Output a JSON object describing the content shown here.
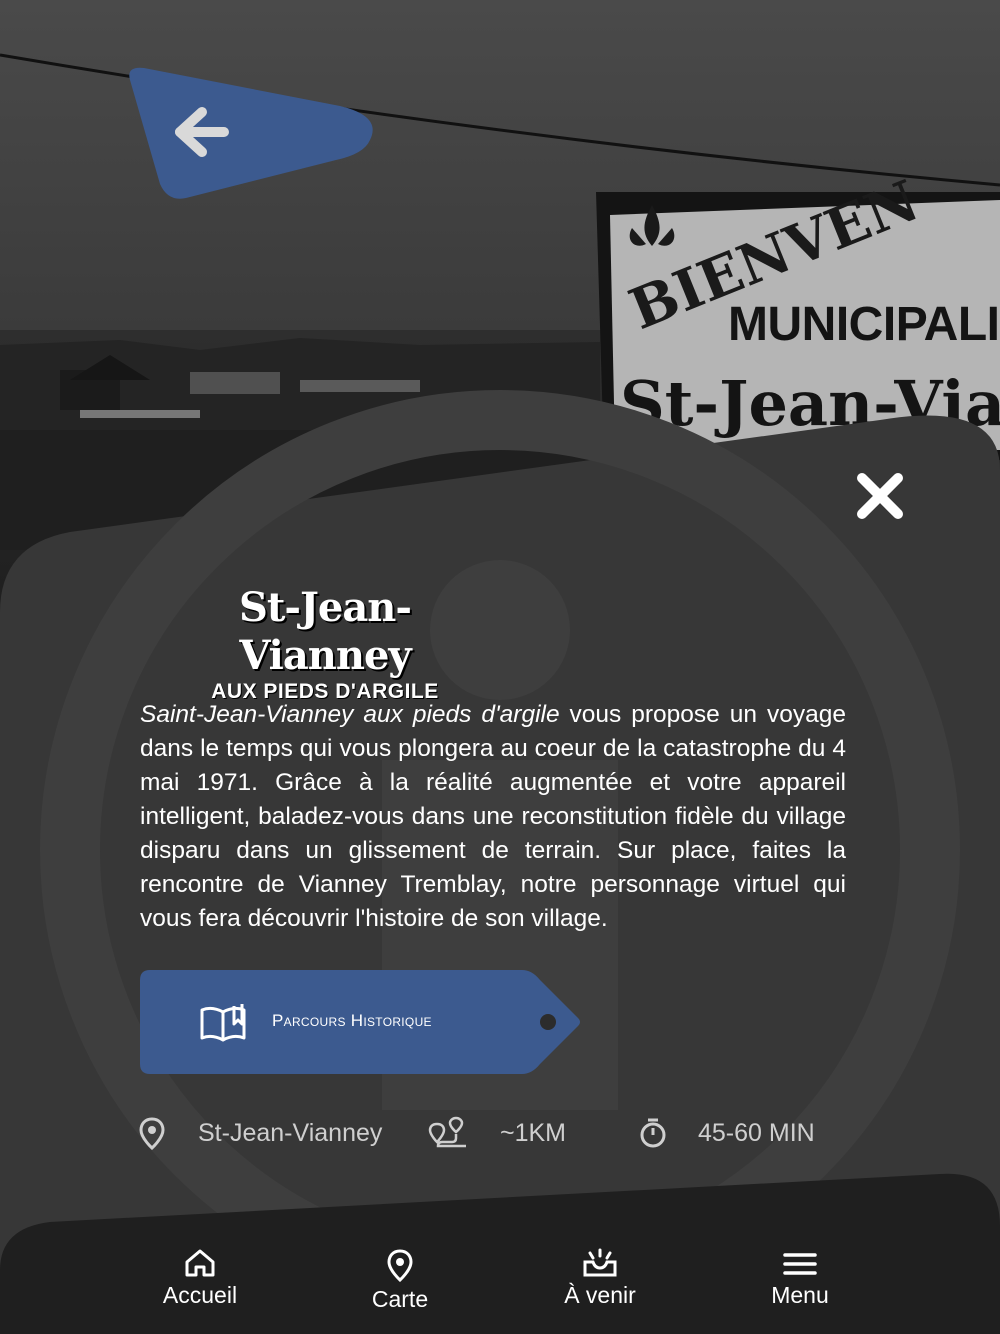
{
  "hero": {
    "sign_line1": "BIENVEN",
    "sign_line2": "MUNICIPALI",
    "sign_line3": "St-Jean-Via"
  },
  "logo": {
    "title": "St-Jean-Vianney",
    "subtitle": "AUX PIEDS D'ARGILE"
  },
  "description": {
    "italic": "Saint-Jean-Vianney aux pieds d'argile",
    "text": " vous propose un voyage dans le temps qui vous plongera au coeur de la catastrophe du 4 mai 1971. Grâce à la réalité augmentée et votre appareil intelligent, baladez-vous dans une reconstitution fidèle du village disparu dans un glissement de terrain. Sur place, faites la rencontre de Vianney Tremblay, notre personnage virtuel qui vous fera découvrir l'histoire de son village."
  },
  "cta": {
    "label": "Parcours Historique",
    "icon": "open-book-icon"
  },
  "meta": {
    "location": "St-Jean-Vianney",
    "distance": "~1KM",
    "duration": "45-60 MIN"
  },
  "nav": {
    "items": [
      {
        "label": "Accueil",
        "icon": "home-icon"
      },
      {
        "label": "Carte",
        "icon": "map-pin-icon"
      },
      {
        "label": "À venir",
        "icon": "upcoming-icon"
      },
      {
        "label": "Menu",
        "icon": "hamburger-icon"
      }
    ]
  },
  "colors": {
    "accent": "#3c5a8f",
    "panel": "#373737",
    "navbar": "#1f1f1f",
    "text": "#ffffff",
    "meta_text": "#cfcfcf"
  }
}
